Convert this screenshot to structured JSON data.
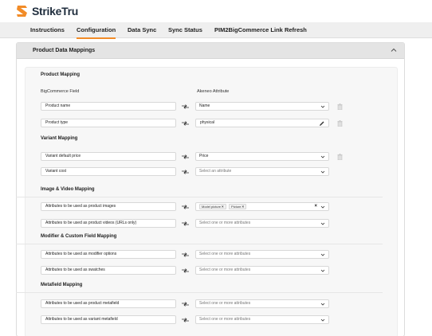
{
  "brand": {
    "name": "StrikeTru",
    "accent": "#f28c28"
  },
  "nav": {
    "tabs": [
      {
        "label": "Instructions"
      },
      {
        "label": "Configuration",
        "active": true
      },
      {
        "label": "Data Sync"
      },
      {
        "label": "Sync Status"
      },
      {
        "label": "PIM2BigCommerce Link Refresh"
      }
    ]
  },
  "panel": {
    "title": "Product Data Mappings",
    "expanded": true
  },
  "product_mapping": {
    "title": "Product Mapping",
    "col_left": "BigCommerce Field",
    "col_right": "Akeneo Attribute",
    "rows": [
      {
        "field": "Product name",
        "attribute": "Name"
      },
      {
        "field": "Product type",
        "attribute": "physical"
      }
    ]
  },
  "variant_mapping": {
    "title": "Variant Mapping",
    "rows": [
      {
        "field": "Variant default price",
        "attribute": "Price"
      },
      {
        "field": "Variant cost",
        "placeholder": "Select an attribute"
      }
    ]
  },
  "image_video_mapping": {
    "title": "Image & Video Mapping",
    "rows": [
      {
        "field": "Attributes to be used as product images",
        "tags": [
          "Model picture",
          "Picture"
        ]
      },
      {
        "field": "Attributes to be used as product videos (URLs only)",
        "placeholder": "Select one or more attributes"
      }
    ]
  },
  "modifier_mapping": {
    "title": "Modifier & Custom Field Mapping",
    "rows": [
      {
        "field": "Attributes to be used as modifier options",
        "placeholder": "Select one or more attributes"
      },
      {
        "field": "Attributes to be used as swatches",
        "placeholder": "Select one or more attributes"
      }
    ]
  },
  "metafield_mapping": {
    "title": "Metafield Mapping",
    "rows": [
      {
        "field": "Attributes to be used as product metafield",
        "placeholder": "Select one or more attributes"
      },
      {
        "field": "Attributes to be used as variant metafield",
        "placeholder": "Select one or more attributes"
      }
    ]
  },
  "icons": {
    "logo": "striketru-logo-icon",
    "collapse": "chevron-up-icon",
    "mapping_arrow": "arrows-exchange-icon",
    "dropdown": "chevron-down-icon",
    "delete": "trash-icon",
    "edit": "pencil-icon",
    "remove_tag": "close-icon"
  }
}
